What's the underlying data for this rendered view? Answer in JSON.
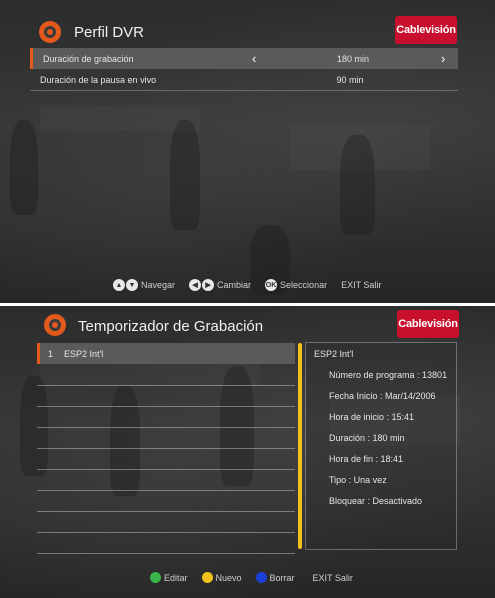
{
  "dvr": {
    "title": "Perfil DVR",
    "brand": "Cablevisión",
    "rows": [
      {
        "label": "Duración de grabación",
        "value": "180 min"
      },
      {
        "label": "Duración de la pausa en vivo",
        "value": "90 min"
      }
    ],
    "footer": {
      "navigate": "Navegar",
      "change": "Cambiar",
      "select": "Seleccionar",
      "ok_key": "OK",
      "exit": "EXIT Salir"
    }
  },
  "timer": {
    "title": "Temporizador de Grabación",
    "brand": "Cablevisión",
    "list": [
      {
        "num": "1",
        "name": "ESP2 Int'l"
      }
    ],
    "detail": {
      "title": "ESP2 Int'l",
      "lines": [
        "Número de programa : 13801",
        "Fecha Inicio : Mar/14/2006",
        "Hora de inicio : 15:41",
        "Duración : 180 min",
        "Hora de fin : 18:41",
        "Tipo : Una vez",
        "Bloquear : Desactivado"
      ]
    },
    "footer": {
      "edit": "Editar",
      "new": "Nuevo",
      "delete": "Borrar",
      "exit": "EXIT Salir"
    },
    "colors": {
      "edit": "#3ab54a",
      "new": "#f2c21b",
      "delete": "#1a3fd6"
    }
  },
  "accent": "#e25a1c",
  "brand_color": "#c8102e"
}
